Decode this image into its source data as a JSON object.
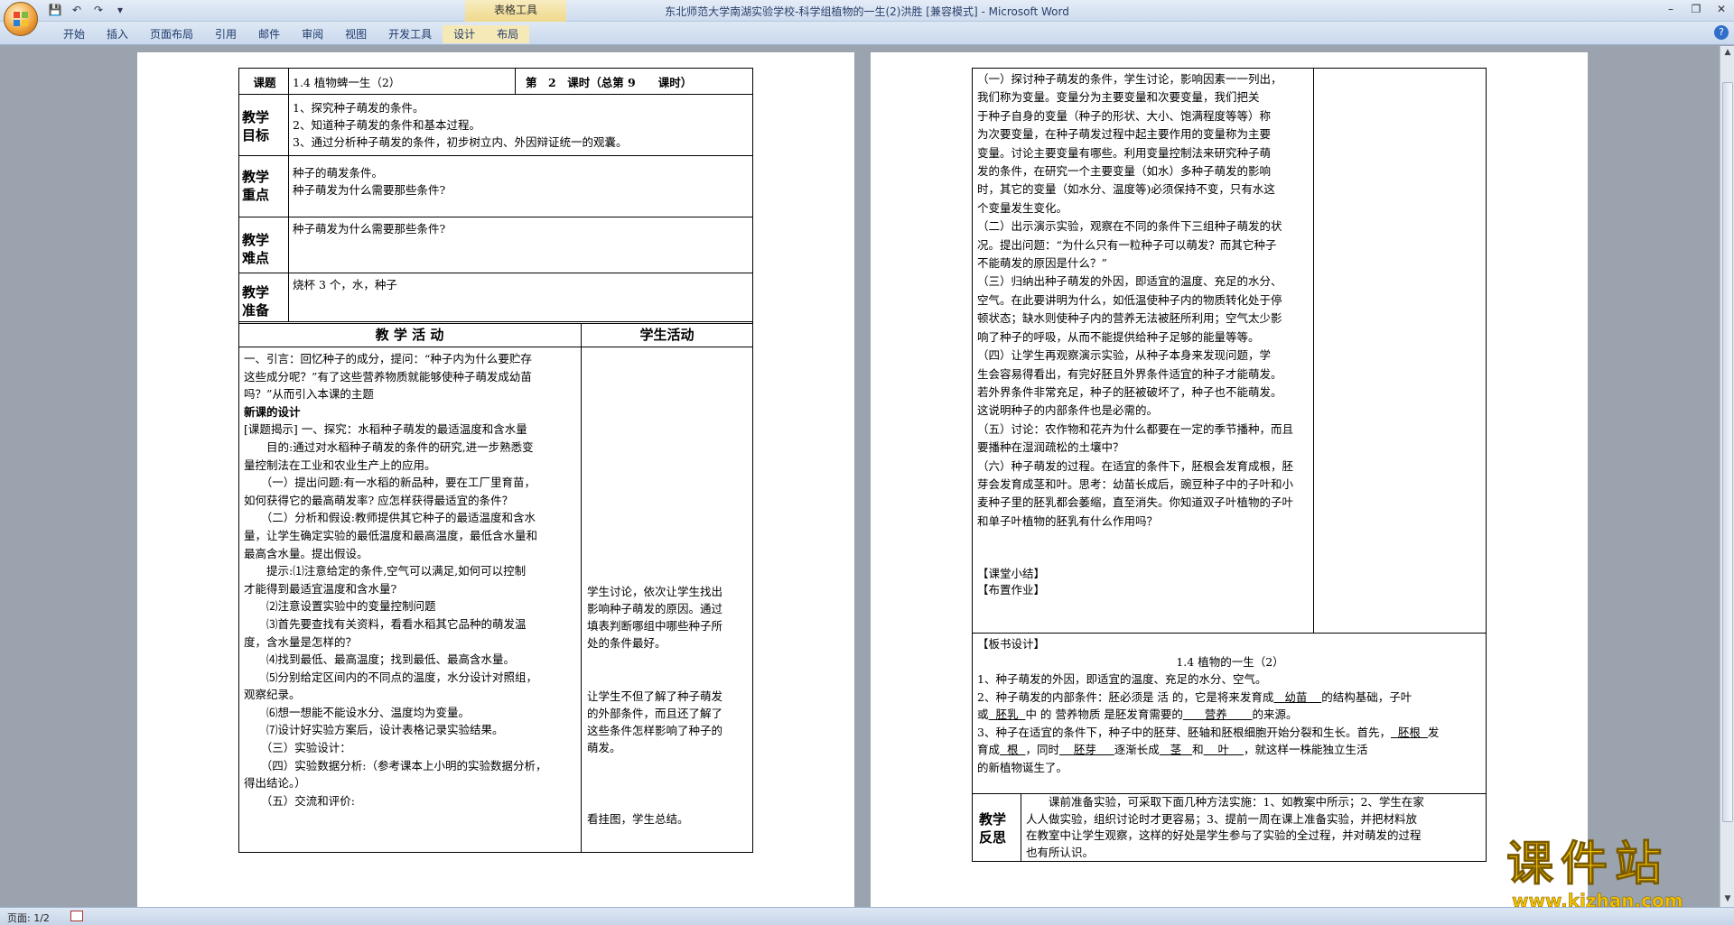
{
  "window": {
    "title": "东北师范大学南湖实验学校-科学组植物的一生(2)洪胜 [兼容模式] - Microsoft Word",
    "context_tab_group": "表格工具",
    "ribbon_tabs": [
      "开始",
      "插入",
      "页面布局",
      "引用",
      "邮件",
      "审阅",
      "视图",
      "开发工具",
      "设计",
      "布局"
    ]
  },
  "statusbar": {
    "page": "页面: 1/2"
  },
  "watermark": {
    "text": "课件站",
    "url": "www.kjzhan.com"
  },
  "page1": {
    "lesson_label": "课题",
    "lesson_title": "1.4 植物蜱一生（2）",
    "lesson_period": "第　2　课时（总第 9　　课时）",
    "goals_label": "教学目标",
    "goals": [
      "1、探究种子萌发的条件。",
      "2、知道种子萌发的条件和基本过程。",
      "3、通过分析种子萌发的条件，初步树立内、外因辩证统一的观囊。"
    ],
    "key_label": "教学重点",
    "key_points": [
      "种子的萌发条件。",
      "种子萌发为什么需要那些条件?"
    ],
    "difficulty_label": "教学难点",
    "difficulty": "种子萌发为什么需要那些条件?",
    "prep_label": "教学准备",
    "prep": "烧杯 3 个，水，种子",
    "activity_header": "教 学 活 动",
    "student_header": "学生活动",
    "activity_lines": [
      "一、引言：回忆种子的成分，提问：“种子内为什么要贮存",
      "这些成分呢？”有了这些营养物质就能够使种子萌发成幼苗",
      "吗？”从而引入本课的主题",
      "新课的设计",
      "[课题揭示] 一、探究：水稻种子萌发的最适温度和含水量",
      "　　目的:通过对水稻种子萌发的条件的研究,进一步熟悉变",
      "量控制法在工业和农业生产上的应用。",
      "　　（一）提出问题:有一水稻的新品种，要在工厂里育苗，",
      "如何获得它的最高萌发率? 应怎样获得最适宜的条件？",
      "　　（二）分析和假设:教师提供其它种子的最适温度和含水",
      "量，让学生确定实验的最低温度和最高温度，最低含水量和",
      "最高含水量。提出假设。",
      "　　提示:⑴注意给定的条件,空气可以满足,如何可以控制",
      "才能得到最适宜温度和含水量?",
      "　　⑵注意设置实验中的变量控制问题",
      "　　⑶首先要查找有关资料，看看水稻其它品种的萌发温",
      "度，含水量是怎样的？",
      "　　⑷找到最低、最高温度；找到最低、最高含水量。",
      "　　⑸分别给定区间内的不同点的温度，水分设计对照组，",
      "观察纪录。",
      "　　⑹想一想能不能设水分、温度均为变量。",
      "　　⑺设计好实验方案后，设计表格记录实验结果。",
      "　　（三）实验设计：",
      "　　（四）实验数据分析:（参考课本上小明的实验数据分析，",
      "得出结论。）",
      "　　（五）交流和评价:"
    ],
    "student_notes": [
      "学生讨论，依次让学生找出",
      "影响种子萌发的原因。通过",
      "填表判断哪组中哪些种子所",
      "处的条件最好。",
      "让学生不但了解了种子萌发",
      "的外部条件，而且还了解了",
      "这些条件怎样影响了种子的",
      "萌发。",
      "看挂图，学生总结。"
    ]
  },
  "page2": {
    "main_lines": [
      "（一）探讨种子萌发的条件，学生讨论，影响因素一一列出，",
      "我们称为变量。变量分为主要变量和次要变量，我们把关",
      "于种子自身的变量（种子的形状、大小、饱满程度等等）称",
      "为次要变量，在种子萌发过程中起主要作用的变量称为主要",
      "变量。讨论主要变量有哪些。利用变量控制法来研究种子萌",
      "发的条件，在研究一个主要变量（如水）多种子萌发的影响",
      "时，其它的变量（如水分、温度等)必须保持不变，只有水这",
      "个变量发生变化。",
      "（二）出示演示实验，观察在不同的条件下三组种子萌发的状",
      "况。提出问题：“为什么只有一粒种子可以萌发？而其它种子",
      "不能萌发的原因是什么？”",
      "（三）归纳出种子萌发的外因，即适宜的温度、充足的水分、",
      "空气。在此要讲明为什么，如低温使种子内的物质转化处于停",
      "顿状态；缺水则使种子内的营养无法被胚所利用；空气太少影",
      "响了种子的呼吸，从而不能提供给种子足够的能量等等。",
      "（四）让学生再观察演示实验，从种子本身来发现问题，学",
      "生会容易得看出，有完好胚且外界条件适宜的种子才能萌发。",
      "若外界条件非常充足，种子的胚被破坏了，种子也不能萌发。",
      "这说明种子的内部条件也是必需的。",
      "（五）讨论：农作物和花卉为什么都要在一定的季节播种，而且",
      "要播种在湿润疏松的土壤中？",
      "（六）种子萌发的过程。在适宜的条件下，胚根会发育成根，胚",
      "芽会发育成茎和叶。思考：幼苗长成后，豌豆种子中的子叶和小",
      "麦种子里的胚乳都会萎缩，直至消失。你知道双子叶植物的子叶",
      "和单子叶植物的胚乳有什么作用吗？"
    ],
    "summary": "【课堂小结】",
    "homework": "【布置作业】",
    "board_label": "【板书设计】",
    "board_title": "1.4 植物的一生（2）",
    "board_line1": "1、种子萌发的外因，即适宜的温度、充足的水分、空气。",
    "board_line2_a": "2、种子萌发的内部条件：胚必须是 活 的，它是将来发育成",
    "board_blank_youmiao": "幼苗",
    "board_line2_b": "的结构基础，子叶",
    "board_line3_a": "或",
    "board_blank_peiru": "胚乳",
    "board_line3_b": "中 的 营养物质 是胚发育需要的",
    "board_blank_yingyang": "营养",
    "board_line3_c": "的来源。",
    "board_line4_a": "3、种子在适宜的条件下，种子中的胚芽、胚轴和胚根细胞开始分裂和生长。首先，",
    "board_blank_peigen": "胚根",
    "board_line4_b": "发",
    "board_line5_a": "育成",
    "board_blank_gen": "根",
    "board_line5_b": "，同时",
    "board_blank_peiya": "胚芽",
    "board_line5_c": "逐渐长成",
    "board_blank_jing": "茎",
    "board_line5_d": "和",
    "board_blank_ye": "叶",
    "board_line5_e": "，就这样一株能独立生活",
    "board_line6": "的新植物诞生了。",
    "reflection_label": "教学反思",
    "reflection_lines": [
      "　　课前准备实验，可采取下面几种方法实施：1、如教案中所示；2、学生在家",
      "人人做实验，组织讨论时才更容易；3、提前一周在课上准备实验，并把材料放",
      "在教室中让学生观察，这样的好处是学生参与了实验的全过程，并对萌发的过程",
      "也有所认识。"
    ]
  }
}
